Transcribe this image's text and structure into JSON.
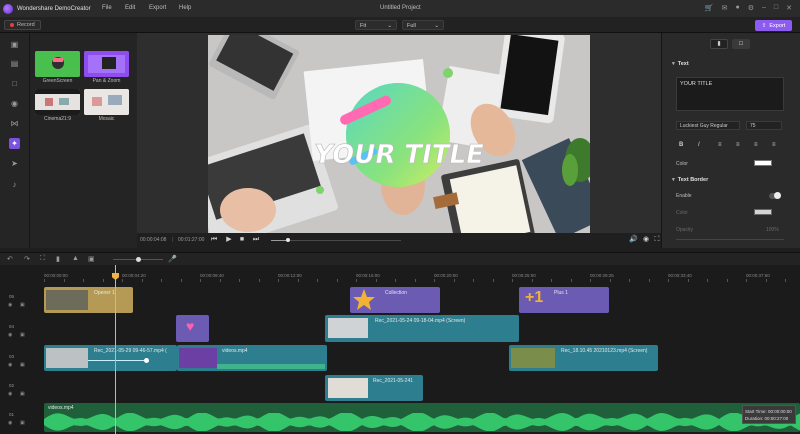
{
  "app": {
    "name": "Wondershare DemoCreator",
    "menu": [
      "File",
      "Edit",
      "Export",
      "Help"
    ],
    "project_title": "Untitled Project",
    "record_label": "Record",
    "export_label": "Export",
    "accent_color": "#8c5cf0"
  },
  "toolbar": {
    "fit_value": "Fit",
    "quality_value": "Full"
  },
  "media": {
    "items": [
      {
        "label": "GreenScreen"
      },
      {
        "label": "Pan & Zoom"
      },
      {
        "label": "Cinema21:9"
      },
      {
        "label": "Mosaic"
      }
    ]
  },
  "preview": {
    "overlay_title": "YOUR TITLE",
    "current_time": "00:00:04:08",
    "total_time": "00:01:27:00",
    "progress_fraction": 0.13
  },
  "properties": {
    "section_text": "Text",
    "text_value": "YOUR TITLE",
    "font_family": "Luckiest Guy Regular",
    "font_size": "75",
    "format_buttons": [
      "B",
      "I"
    ],
    "color_label": "Color",
    "section_border": "Text Border",
    "enable_label": "Enable",
    "border_color_label": "Color",
    "opacity_label": "Opacity",
    "opacity_value": "100%",
    "border_enabled": true
  },
  "timeline": {
    "ruler_ticks": [
      "00:00:00:00",
      "00:00:04:20",
      "00:00:09:40",
      "00:00:12:00",
      "00:00:16:00",
      "00:00:20:00",
      "00:00:25:00",
      "00:00:29:25",
      "00:00:33:40",
      "00:00:37:60"
    ],
    "tracks": [
      "05",
      "04",
      "03",
      "02",
      "01"
    ],
    "clips": {
      "opener": "Opener 1",
      "collection": "Collection",
      "plus": "Plus 1",
      "rec_screen_1": "Rec_2021-05-24 09-18-04.mp4 (Screen)",
      "rec_short": "Rec_2021-05-29 09-46-57.mp4 (",
      "videos1": "videos.mp4",
      "rec_screen_2": "Rec_18.10.45 20210123.mp4 (Screen)",
      "rec_small": "Rec_2021-05-241",
      "audio": "videos.mp4"
    },
    "info_start": "Start Time: 00:00:00:00",
    "info_duration": "Duration: 00:00:27:00"
  }
}
